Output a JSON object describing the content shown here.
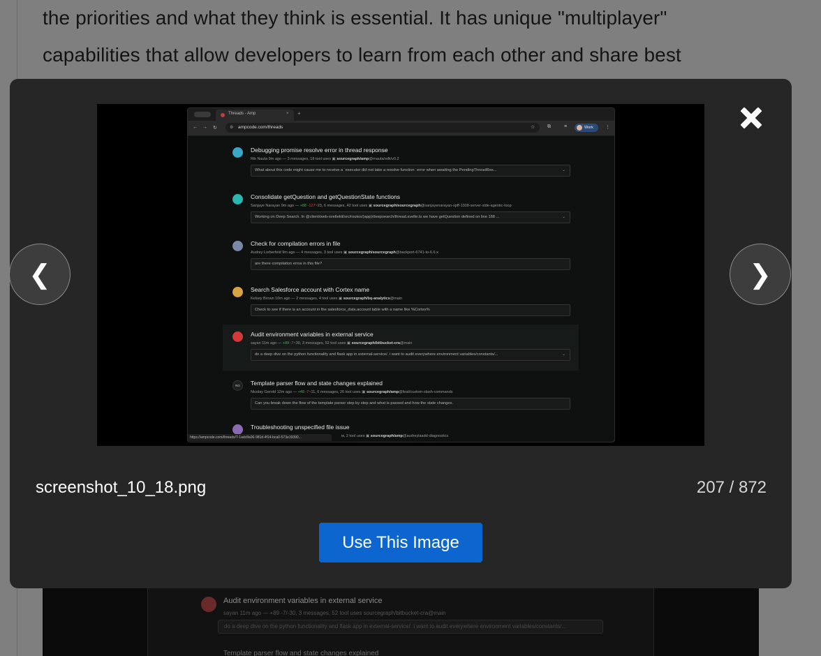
{
  "background": {
    "text_line_1": "the priorities and what they think is essential. It has unique \"multiplayer\"",
    "text_line_2": "capabilities that allow developers to learn from each other and share best",
    "peek_thread_title": "Audit environment variables in external service",
    "peek_thread_meta": "sayan 11m ago — +89 -7/-30, 3 messages, 52 tool uses  sourcegraph/bitbucket-cra@main",
    "peek_thread_prompt": "do a deep dive on the python functionality and flask app in external-service/. i want to audit everywhere environment variables/constants/...",
    "peek_next_title": "Template parser flow and state changes explained"
  },
  "modal": {
    "close_icon": "close-icon",
    "prev_label": "❮",
    "next_label": "❯",
    "filename": "screenshot_10_18.png",
    "counter": "207 / 872",
    "use_button_label": "Use This Image"
  },
  "preview": {
    "tab_title": "Threads - Amp",
    "tab_close": "×",
    "new_tab": "+",
    "url": "ampcode.com/threads",
    "profile_label": "Work",
    "status_url": "https://ampcode.com/threads/T-1adc8a06-981d-4f14-bca0-573e19390...",
    "threads": [
      {
        "title": "Debugging promise resolve error in thread response",
        "author_time": "Rik Nauta 9m ago — 3 messages, 18 tool uses",
        "repo": "sourcegraph/amp",
        "branch": "@rnauta/sdk/v0.2",
        "prompt": "What about this code might cause me to receive a `executor did not take a resolve function` error when awaiting the PendingThreadRes...",
        "avatar_color": "#3aa6c9"
      },
      {
        "title": "Consolidate getQuestion and getQuestionState functions",
        "author_time": "Sanjaye Narayan 9m ago —",
        "adds": "+88",
        "dels": "-127",
        "stats": "~23, 6 messages, 42 tool uses",
        "repo": "sourcegraph/sourcegraph",
        "branch": "@sanjayenarayan-spff-1308-server-side-agentic-loop",
        "prompt": "Working on Deep Search. In @client/web-sveltekit/src/routes/(app)/deepsearch/thread.svelte.ts we have getQuestion defined on line 168 ...",
        "avatar_color": "#2bb6b0"
      },
      {
        "title": "Check for compilation errors in file",
        "author_time": "Audrey Lorberfeld 9m ago — 4 messages, 3 tool uses",
        "repo": "sourcegraph/sourcegraph",
        "branch": "@backport-6741-to-6.6.x",
        "prompt": "are there compilation erros in this file?",
        "avatar_color": "#7a8aa6"
      },
      {
        "title": "Search Salesforce account with Cortex name",
        "author_time": "Kelsey Brown 10m ago — 2 messages, 4 tool uses",
        "repo": "sourcegraph/bq-analytics",
        "branch": "@main",
        "prompt": "Check to see if there is an account in the salesforce_data.account table with a name like %Cortex%",
        "avatar_color": "#d9a441"
      },
      {
        "title": "Audit environment variables in external service",
        "author_time": "sayan 11m ago —",
        "adds": "+89",
        "dels": "-7",
        "stats": "~30, 3 messages, 52 tool uses",
        "repo": "sourcegraph/bitbucket-cra",
        "branch": "@main",
        "prompt": "do a deep dive on the python functionality and flask app in external-service/. i want to audit everywhere environment variables/constants/...",
        "avatar_color": "#d23a3a"
      },
      {
        "title": "Template parser flow and state changes explained",
        "author_time": "Nicolay Gerold 12m ago —",
        "adds": "+48",
        "dels": "-7",
        "stats": "~11, 6 messages, 26 tool uses",
        "repo": "sourcegraph/amp",
        "branch": "@feat/custom-slash-commands",
        "prompt": "Can you break down the flow of the template parser step by step and what is passed and how the state changes.",
        "avatar_initials": "NG"
      },
      {
        "title": "Troubleshooting unspecified file issue",
        "author_time": "м, 2 tool uses",
        "repo": "sourcegraph/amp",
        "branch": "@audreylaadd-diagnostics",
        "avatar_color": "#8a6ab0"
      }
    ]
  }
}
